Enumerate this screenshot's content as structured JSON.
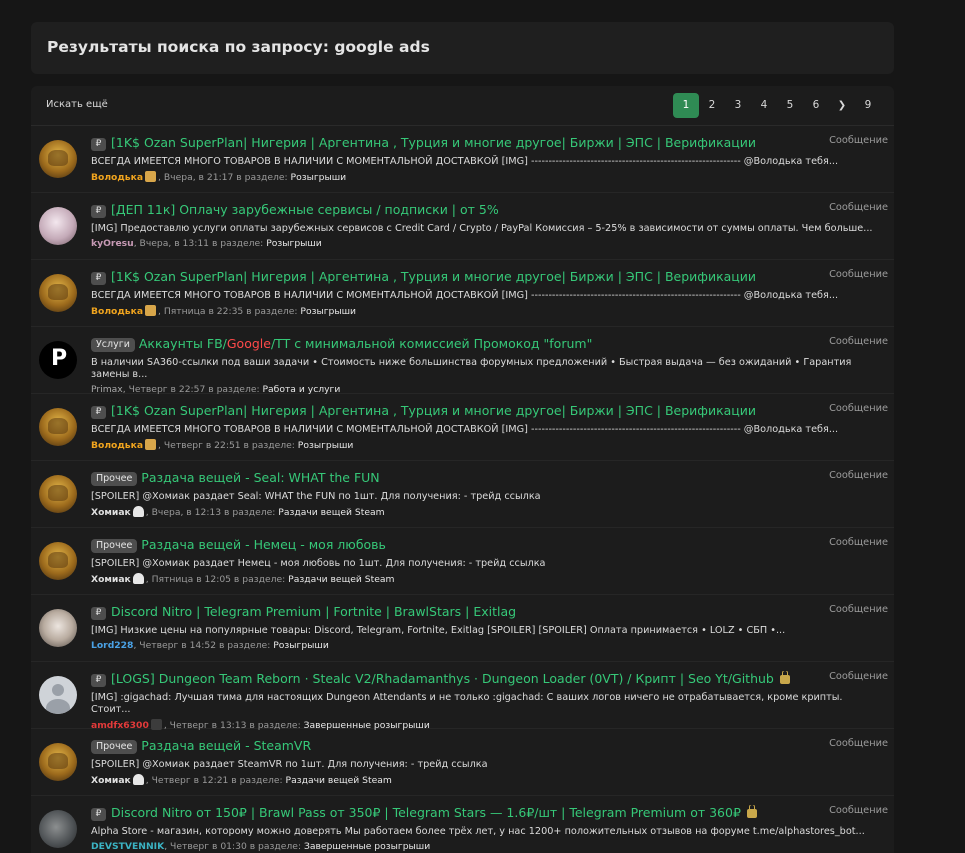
{
  "header": {
    "title": "Результаты поиска по запросу: google ads"
  },
  "toolbar": {
    "search_more": "Искать ещё"
  },
  "pagination": {
    "pages": [
      "1",
      "2",
      "3",
      "4",
      "5",
      "6"
    ],
    "current": "1",
    "next_icon": "chevron-right-icon",
    "last": "9"
  },
  "section_prefix": "в разделе:",
  "results": [
    {
      "avatar": "gold",
      "prefix_icon": "P",
      "prefix": "",
      "title": "[1K$ Ozan SuperPlan| Нигерия | Аргентина , Турция и многие другое| Биржи | ЭПС | Верификации",
      "lock": false,
      "snippet": "ВСЕГДА ИМЕЕТСЯ МНОГО ТОВАРОВ В НАЛИЧИИ С МОМЕНТАЛЬНОЙ ДОСТАВКОЙ [IMG] ------------------------------------------------------------ @Володька тебя...",
      "author": "Володька",
      "author_class": "gold",
      "emoji": "hand",
      "date": "Вчера, в 21:17",
      "section": "Розыгрыши",
      "type": "Сообщение"
    },
    {
      "avatar": "pink",
      "prefix_icon": "P",
      "prefix": "",
      "title": "[ДЕП 11к] Оплачу зарубежные сервисы / подписки | от 5%",
      "lock": false,
      "snippet": "[IMG] Предоставлю услуги оплаты зарубежных сервисов с Credit Card / Crypto / PayPal Комиссия – 5-25% в зависимости от суммы оплаты. Чем больше...",
      "author": "kyOresu",
      "author_class": "pink",
      "emoji": "",
      "date": "Вчера, в 13:11",
      "section": "Розыгрыши",
      "type": "Сообщение"
    },
    {
      "avatar": "gold",
      "prefix_icon": "P",
      "prefix": "",
      "title": "[1K$ Ozan SuperPlan| Нигерия | Аргентина , Турция и многие другое| Биржи | ЭПС | Верификации",
      "lock": false,
      "snippet": "ВСЕГДА ИМЕЕТСЯ МНОГО ТОВАРОВ В НАЛИЧИИ С МОМЕНТАЛЬНОЙ ДОСТАВКОЙ [IMG] ------------------------------------------------------------ @Володька тебя...",
      "author": "Володька",
      "author_class": "gold",
      "emoji": "hand",
      "date": "Пятница в 22:35",
      "section": "Розыгрыши",
      "type": "Сообщение"
    },
    {
      "avatar": "p",
      "prefix_icon": "",
      "prefix": "Услуги",
      "title_before": "Аккаунты FB/",
      "title_highlight": "Google",
      "title_after": "/TT с минимальной комиссией Промокод \"forum\"",
      "lock": false,
      "snippet": "В наличии SA360-ссылки под ваши задачи • Стоимость ниже большинства форумных предложений • Быстрая выдача — без ожиданий • Гарантия замены в...",
      "author": "Primax",
      "author_class": "grey",
      "emoji": "",
      "date": "Четверг в 22:57",
      "section": "Работа и услуги",
      "type": "Сообщение"
    },
    {
      "avatar": "gold",
      "prefix_icon": "P",
      "prefix": "",
      "title": "[1K$ Ozan SuperPlan| Нигерия | Аргентина , Турция и многие другое| Биржи | ЭПС | Верификации",
      "lock": false,
      "snippet": "ВСЕГДА ИМЕЕТСЯ МНОГО ТОВАРОВ В НАЛИЧИИ С МОМЕНТАЛЬНОЙ ДОСТАВКОЙ [IMG] ------------------------------------------------------------ @Володька тебя...",
      "author": "Володька",
      "author_class": "gold",
      "emoji": "hand",
      "date": "Четверг в 22:51",
      "section": "Розыгрыши",
      "type": "Сообщение"
    },
    {
      "avatar": "gold",
      "prefix_icon": "",
      "prefix": "Прочее",
      "title": "Раздача вещей - Seal: WHAT the FUN",
      "lock": false,
      "snippet": "[SPOILER] @Хомиак раздает Seal: WHAT the FUN по 1шт. Для получения: - трейд ссылка",
      "author": "Хомиак",
      "author_class": "white",
      "emoji": "ghost",
      "date": "Вчера, в 12:13",
      "section": "Раздачи вещей Steam",
      "type": "Сообщение"
    },
    {
      "avatar": "gold",
      "prefix_icon": "",
      "prefix": "Прочее",
      "title": "Раздача вещей - Немец - моя любовь",
      "lock": false,
      "snippet": "[SPOILER] @Хомиак раздает Немец - моя любовь по 1шт. Для получения: - трейд ссылка",
      "author": "Хомиак",
      "author_class": "white",
      "emoji": "ghost",
      "date": "Пятница в 12:05",
      "section": "Раздачи вещей Steam",
      "type": "Сообщение"
    },
    {
      "avatar": "girl",
      "prefix_icon": "P",
      "prefix": "",
      "title": "Discord Nitro | Telegram Premium | Fortnite | BrawlStars | Exitlag",
      "lock": false,
      "snippet": "[IMG] Низкие цены на популярные товары: Discord, Telegram, Fortnite, Exitlag [SPOILER] [SPOILER] Оплата принимается • LOLZ • СБП •...",
      "author": "Lord228",
      "author_class": "blue",
      "emoji": "",
      "date": "Четверг в 14:52",
      "section": "Розыгрыши",
      "type": "Сообщение"
    },
    {
      "avatar": "user",
      "prefix_icon": "P",
      "prefix": "",
      "title": "[LOGS] Dungeon Team Reborn · Stealc V2/Rhadamanthys · Dungeon Loader (0VT) / Крипт | Seo Yt/Github",
      "lock": true,
      "snippet": "[IMG] :gigachad: Лучшая тима для настоящих Dungeon Attendants и не только :gigachad: С ваших логов ничего не отрабатывается, кроме крипты. Стоит...",
      "author": "amdfx6300",
      "author_class": "red",
      "emoji": "dark",
      "date": "Четверг в 13:13",
      "section": "Завершенные розыгрыши",
      "type": "Сообщение"
    },
    {
      "avatar": "gold",
      "prefix_icon": "",
      "prefix": "Прочее",
      "title": "Раздача вещей - SteamVR",
      "lock": false,
      "snippet": "[SPOILER] @Хомиак раздает SteamVR по 1шт. Для получения: - трейд ссылка",
      "author": "Хомиак",
      "author_class": "white",
      "emoji": "ghost",
      "date": "Четверг в 12:21",
      "section": "Раздачи вещей Steam",
      "type": "Сообщение"
    },
    {
      "avatar": "guy",
      "prefix_icon": "P",
      "prefix": "",
      "title": "Discord Nitro от 150₽ | Brawl Pass от 350₽ | Telegram Stars — 1.6₽/шт | Telegram Premium от 360₽",
      "lock": true,
      "snippet": "Alpha Store - магазин, которому можно доверять Мы работаем более трёх лет, у нас 1200+ положительных отзывов на форуме t.me/alphastores_bot...",
      "author": "DEVSTVENNIK",
      "author_class": "teal",
      "emoji": "",
      "date": "Четверг в 01:30",
      "section": "Завершенные розыгрыши",
      "type": "Сообщение"
    }
  ]
}
